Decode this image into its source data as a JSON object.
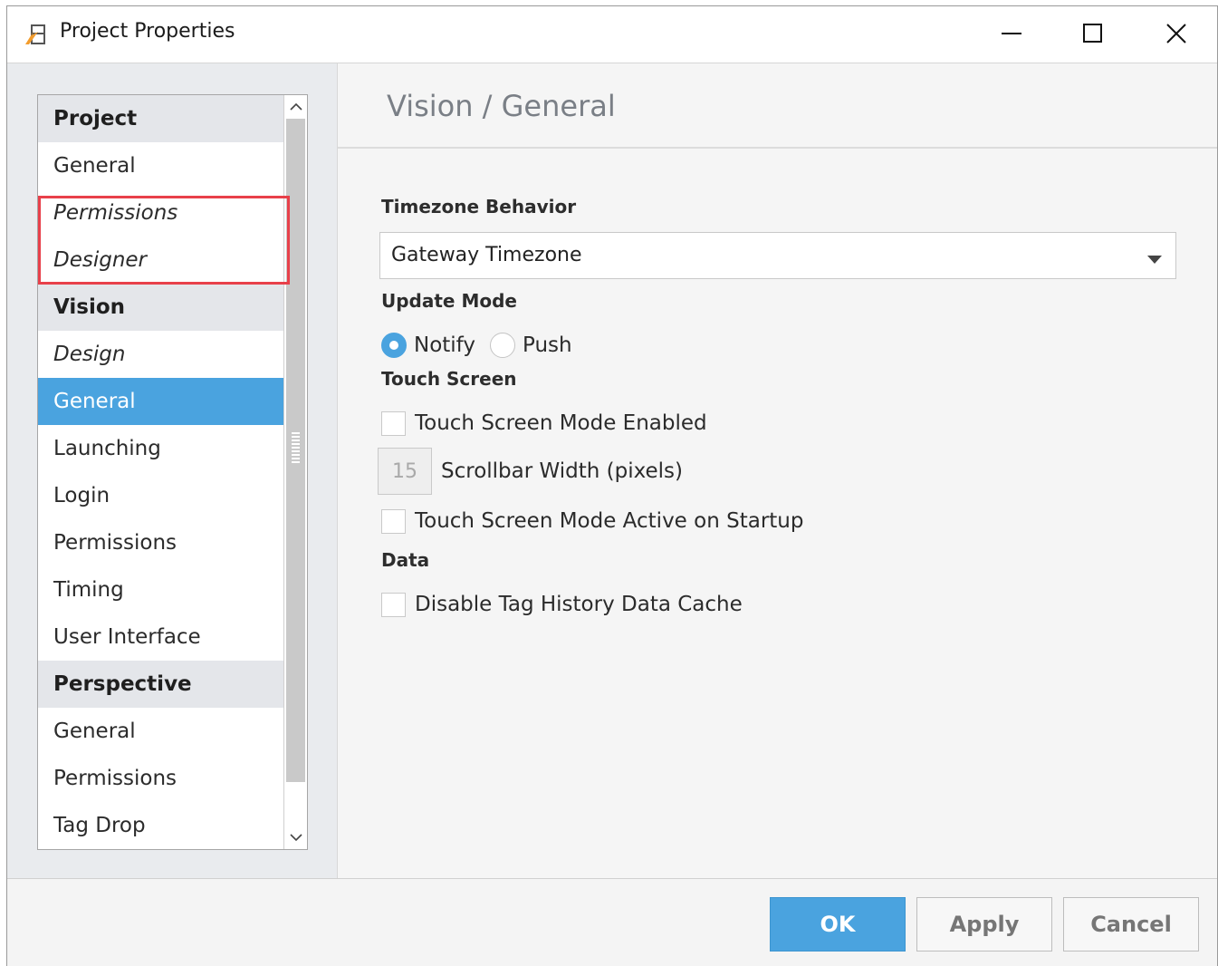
{
  "window": {
    "title": "Project Properties",
    "app_icon": "ignition-designer-icon",
    "controls": {
      "minimize": "minimize-icon",
      "maximize": "maximize-icon",
      "close": "close-icon"
    }
  },
  "nav": {
    "items": [
      {
        "label": "Project",
        "type": "header"
      },
      {
        "label": "General",
        "type": "item"
      },
      {
        "label": "Permissions",
        "type": "item",
        "italic": true
      },
      {
        "label": "Designer",
        "type": "item",
        "italic": true
      },
      {
        "label": "Vision",
        "type": "header"
      },
      {
        "label": "Design",
        "type": "item",
        "italic": true
      },
      {
        "label": "General",
        "type": "item",
        "selected": true
      },
      {
        "label": "Launching",
        "type": "item"
      },
      {
        "label": "Login",
        "type": "item"
      },
      {
        "label": "Permissions",
        "type": "item"
      },
      {
        "label": "Timing",
        "type": "item"
      },
      {
        "label": "User Interface",
        "type": "item"
      },
      {
        "label": "Perspective",
        "type": "header"
      },
      {
        "label": "General",
        "type": "item"
      },
      {
        "label": "Permissions",
        "type": "item"
      },
      {
        "label": "Tag Drop",
        "type": "item"
      }
    ],
    "highlight_color": "#e8404a",
    "selected_color": "#4aa3df"
  },
  "panel": {
    "title": "Vision / General",
    "timezone": {
      "label": "Timezone Behavior",
      "value": "Gateway Timezone"
    },
    "update_mode": {
      "label": "Update Mode",
      "options": [
        "Notify",
        "Push"
      ],
      "selected": "Notify"
    },
    "touch_screen": {
      "label": "Touch Screen",
      "mode_enabled": "Touch Screen Mode Enabled",
      "scrollbar_width_value": "15",
      "scrollbar_width_label": "Scrollbar Width (pixels)",
      "active_on_startup": "Touch Screen Mode Active on Startup"
    },
    "data": {
      "label": "Data",
      "disable_cache": "Disable Tag History Data Cache"
    }
  },
  "footer": {
    "ok": "OK",
    "apply": "Apply",
    "cancel": "Cancel"
  },
  "colors": {
    "accent": "#4aa3df",
    "highlight": "#e8404a"
  }
}
